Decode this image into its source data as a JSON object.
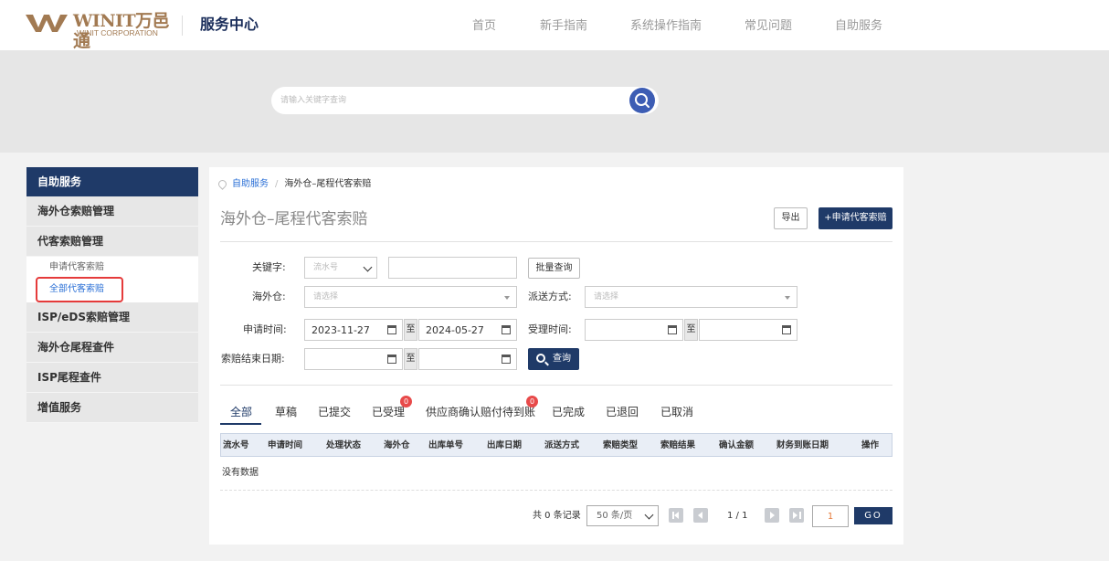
{
  "header": {
    "logo_brand": "WINIT万邑通",
    "logo_corp": "WINIT CORPORATION",
    "service_center": "服务中心",
    "nav": [
      "首页",
      "新手指南",
      "系统操作指南",
      "常见问题",
      "自助服务"
    ]
  },
  "search": {
    "placeholder": "请输入关键字查询"
  },
  "sidebar": {
    "title": "自助服务",
    "items": [
      "海外仓索赔管理",
      "代客索赔管理",
      "ISP/eDS索赔管理",
      "海外仓尾程查件",
      "ISP尾程查件",
      "增值服务"
    ],
    "sub_items": [
      "申请代客索赔",
      "全部代客索赔"
    ]
  },
  "breadcrumb": {
    "home": "自助服务",
    "separator": "/",
    "current": "海外仓–尾程代客索赔"
  },
  "page": {
    "title": "海外仓–尾程代客索赔",
    "export_label": "导出",
    "apply_label": "+申请代客索赔"
  },
  "filters": {
    "keyword_label": "关键字:",
    "keyword_type": "流水号",
    "batch_label": "批量查询",
    "warehouse_label": "海外仓:",
    "warehouse_placeholder": "请选择",
    "delivery_label": "派送方式:",
    "delivery_placeholder": "请选择",
    "apply_time_label": "申请时间:",
    "apply_start": "2023-11-27",
    "apply_end": "2024-05-27",
    "to_label": "至",
    "accept_time_label": "受理时间:",
    "end_date_label": "索赔结束日期:",
    "query_label": "查询"
  },
  "tabs": [
    {
      "label": "全部"
    },
    {
      "label": "草稿"
    },
    {
      "label": "已提交"
    },
    {
      "label": "已受理",
      "badge": "0"
    },
    {
      "label": "供应商确认赔付待到账",
      "badge": "0"
    },
    {
      "label": "已完成"
    },
    {
      "label": "已退回"
    },
    {
      "label": "已取消"
    }
  ],
  "table": {
    "columns": [
      "流水号",
      "申请时间",
      "处理状态",
      "海外仓",
      "出库单号",
      "出库日期",
      "派送方式",
      "索赔类型",
      "索赔结果",
      "确认金额",
      "财务到账日期",
      "操作"
    ],
    "empty_text": "没有数据"
  },
  "pagination": {
    "total_text": "共 0 条记录",
    "page_size": "50 条/页",
    "page_info": "1 / 1",
    "page_input": "1",
    "go_label": "GO"
  },
  "colors": {
    "primary": "#1f3a68",
    "link": "#2a6fd6",
    "badge": "#e84a4a",
    "brand": "#a27a52",
    "highlight_box": "#e53b3b"
  }
}
